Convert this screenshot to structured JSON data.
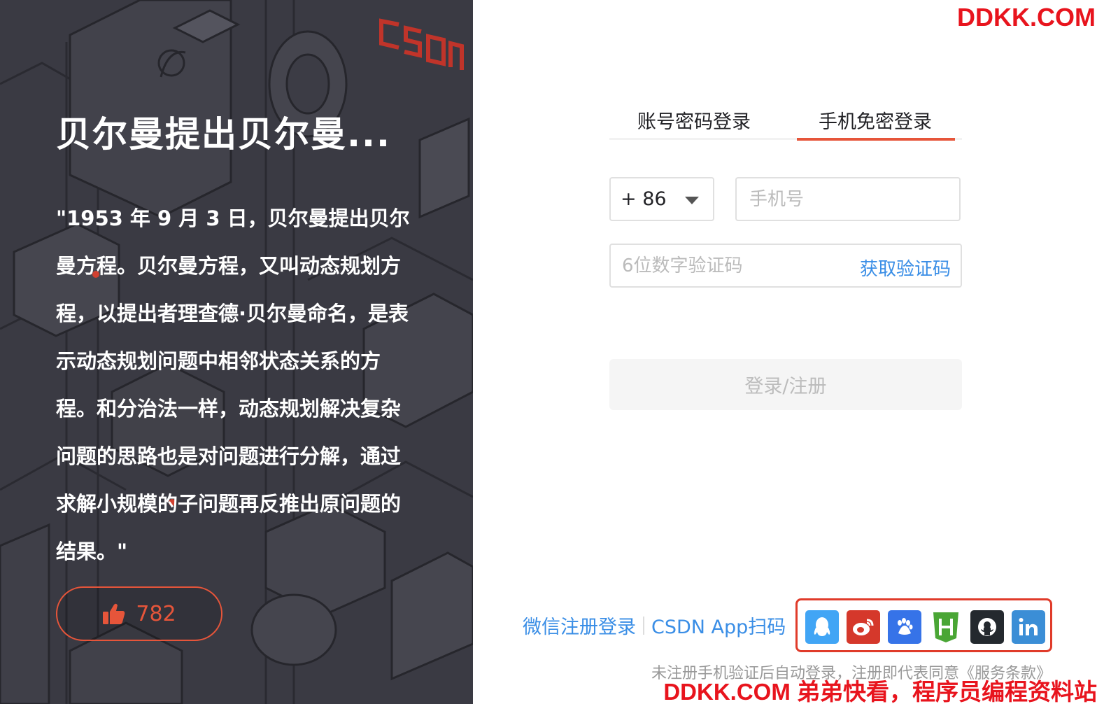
{
  "promo": {
    "title": "贝尔曼提出贝尔曼...",
    "quote": "\"1953 年 9 月 3 日，贝尔曼提出贝尔曼方程。贝尔曼方程，又叫动态规划方程，以提出者理查德·贝尔曼命名，是表示动态规划问题中相邻状态关系的方程。和分治法一样，动态规划解决复杂问题的思路也是对问题进行分解，通过求解小规模的子问题再反推出原问题的结果。\"",
    "like_count": "782",
    "logo_text": "CSDN"
  },
  "login": {
    "tabs": [
      "账号密码登录",
      "手机免密登录"
    ],
    "active_tab": "手机免密登录",
    "country_code": "+ 86",
    "phone_placeholder": "手机号",
    "code_placeholder": "6位数字验证码",
    "get_code_label": "获取验证码",
    "submit_label": "登录/注册",
    "wechat_link": "微信注册登录",
    "app_scan_link": "CSDN App扫码",
    "notice": "未注册手机验证后自动登录，注册即代表同意《服务条款》"
  },
  "social": [
    {
      "name": "qq",
      "icon": "qq-icon",
      "color": "#41a5f5"
    },
    {
      "name": "weibo",
      "icon": "weibo-icon",
      "color": "#d5382b"
    },
    {
      "name": "baidu",
      "icon": "baidu-icon",
      "color": "#3673e8"
    },
    {
      "name": "h",
      "icon": "h-shield-icon",
      "color": "#4aa635"
    },
    {
      "name": "github",
      "icon": "github-icon",
      "color": "#24292e"
    },
    {
      "name": "linkedin",
      "icon": "linkedin-icon",
      "color": "#3b8ed6"
    }
  ],
  "watermark": {
    "top": "DDKK.COM",
    "bottom": "DDKK.COM 弟弟快看，程序员编程资料站"
  },
  "colors": {
    "accent": "#e6553a",
    "link": "#3a8ee6",
    "panel_bg": "#3b3b44",
    "highlight_box": "#e03b2a"
  }
}
